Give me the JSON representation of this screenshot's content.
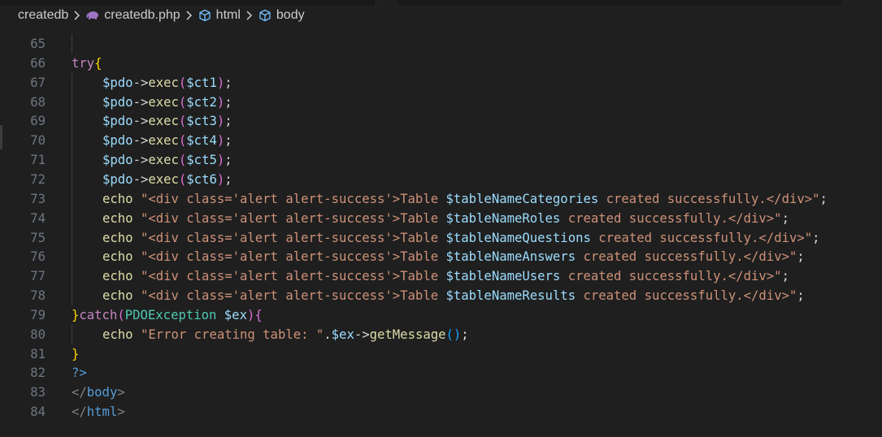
{
  "breadcrumb": {
    "folder": "createdb",
    "file": "createdb.php",
    "symbol1": "html",
    "symbol2": "body",
    "icons": [
      "chevron-right-icon",
      "php-elephant-icon",
      "cube-icon"
    ]
  },
  "colors": {
    "background": "#1f1f1f",
    "line_number": "#6e7681",
    "keyword": "#c586c0",
    "variable": "#9cdcfe",
    "function": "#dcdcaa",
    "string": "#ce9178",
    "class": "#4ec9b0",
    "tag": "#569cd6"
  },
  "lines": [
    {
      "n": "65"
    },
    {
      "n": "66",
      "t": [
        "try",
        "{"
      ]
    },
    {
      "n": "67",
      "t": [
        "$pdo",
        "->",
        "exec",
        "(",
        "$ct1",
        ")",
        ";"
      ]
    },
    {
      "n": "68",
      "t": [
        "$pdo",
        "->",
        "exec",
        "(",
        "$ct2",
        ")",
        ";"
      ]
    },
    {
      "n": "69",
      "t": [
        "$pdo",
        "->",
        "exec",
        "(",
        "$ct3",
        ")",
        ";"
      ]
    },
    {
      "n": "70",
      "t": [
        "$pdo",
        "->",
        "exec",
        "(",
        "$ct4",
        ")",
        ";"
      ]
    },
    {
      "n": "71",
      "t": [
        "$pdo",
        "->",
        "exec",
        "(",
        "$ct5",
        ")",
        ";"
      ]
    },
    {
      "n": "72",
      "t": [
        "$pdo",
        "->",
        "exec",
        "(",
        "$ct6",
        ")",
        ";"
      ]
    },
    {
      "n": "73",
      "t": [
        "echo",
        "\"<div class='alert alert-success'>Table ",
        "$tableNameCategories",
        " created successfully.</div>\"",
        ";"
      ]
    },
    {
      "n": "74",
      "t": [
        "echo",
        "\"<div class='alert alert-success'>Table ",
        "$tableNameRoles",
        " created successfully.</div>\"",
        ";"
      ]
    },
    {
      "n": "75",
      "t": [
        "echo",
        "\"<div class='alert alert-success'>Table ",
        "$tableNameQuestions",
        " created successfully.</div>\"",
        ";"
      ]
    },
    {
      "n": "76",
      "t": [
        "echo",
        "\"<div class='alert alert-success'>Table ",
        "$tableNameAnswers",
        " created successfully.</div>\"",
        ";"
      ]
    },
    {
      "n": "77",
      "t": [
        "echo",
        "\"<div class='alert alert-success'>Table ",
        "$tableNameUsers",
        " created successfully.</div>\"",
        ";"
      ]
    },
    {
      "n": "78",
      "t": [
        "echo",
        "\"<div class='alert alert-success'>Table ",
        "$tableNameResults",
        " created successfully.</div>\"",
        ";"
      ]
    },
    {
      "n": "79",
      "t": [
        "}",
        "catch",
        "(",
        "PDOException",
        " ",
        "$ex",
        ")",
        "{"
      ]
    },
    {
      "n": "80",
      "t": [
        "echo",
        "\"Error creating table: \"",
        ".",
        "$ex",
        "->",
        "getMessage",
        "(",
        ")",
        ";"
      ]
    },
    {
      "n": "81",
      "t": [
        "}"
      ]
    },
    {
      "n": "82",
      "t": [
        "?>"
      ]
    },
    {
      "n": "83",
      "t": [
        "</",
        "body",
        ">"
      ]
    },
    {
      "n": "84",
      "t": [
        "</",
        "html",
        ">"
      ]
    }
  ]
}
